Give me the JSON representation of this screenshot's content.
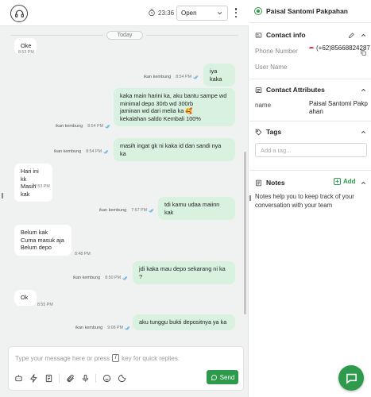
{
  "topbar": {
    "timer": "23:36",
    "status": "Open"
  },
  "messages": {
    "date_divider": "Today",
    "items": [
      {
        "dir": "in",
        "text": "Oke",
        "time": "8:53 PM"
      },
      {
        "dir": "out",
        "text": "iya kaka",
        "sender": "ikan kembung",
        "time": "8:54 PM"
      },
      {
        "dir": "out",
        "text": "kaka main harini ka, aku bantu sampe wd\nminimal depo 30rb wd 300rb\njaminan wd dari melia ka 🥰\nkekalahan saldo Kembali 100%",
        "sender": "ikan kembung",
        "time": "8:54 PM"
      },
      {
        "dir": "out",
        "text": "masih ingat gk ni kaka id dan sandi nya ka",
        "sender": "ikan kembung",
        "time": "8:54 PM"
      },
      {
        "dir": "in",
        "text": "Hari ini kk\nMasih kak",
        "time": "7:53 PM"
      },
      {
        "dir": "out",
        "text": "tdi kamu udaa maiinn kak",
        "sender": "ikan kembung",
        "time": "7:57 PM"
      },
      {
        "dir": "in",
        "text": "Belum kak\nCuma masuk aja\nBelum depo",
        "time": "8:48 PM"
      },
      {
        "dir": "out",
        "text": "jdi kaka mau depo sekarang ni ka ?",
        "sender": "ikan kembung",
        "time": "8:50 PM"
      },
      {
        "dir": "in",
        "text": "Ok",
        "time": "8:55 PM"
      },
      {
        "dir": "out",
        "text": "aku tunggu bukti depositnya ya ka",
        "sender": "ikan kembung",
        "time": "9:08 PM"
      }
    ]
  },
  "composer": {
    "placeholder_before": "Type your message here or press",
    "shortcut_key": "/",
    "placeholder_after": "key for quick replies.",
    "send_label": "Send"
  },
  "contact": {
    "name": "Paisal Santomi Pakpahan"
  },
  "contact_info": {
    "title": "Contact info",
    "phone_label": "Phone Number",
    "phone_value": "(+62)85668824287",
    "username_label": "User Name"
  },
  "contact_attributes": {
    "title": "Contact Attributes",
    "name_label": "name",
    "name_value": "Paisal Santomi Pakpahan"
  },
  "tags": {
    "title": "Tags",
    "placeholder": "Add a tag..."
  },
  "notes": {
    "title": "Notes",
    "add_label": "Add",
    "help": "Notes help you to keep track of your conversation with your team"
  },
  "colors": {
    "accent": "#2e9a4b",
    "bubble_out": "#d9f2e0",
    "chat_bg": "#f0f2f1",
    "tick": "#4aa3df"
  }
}
